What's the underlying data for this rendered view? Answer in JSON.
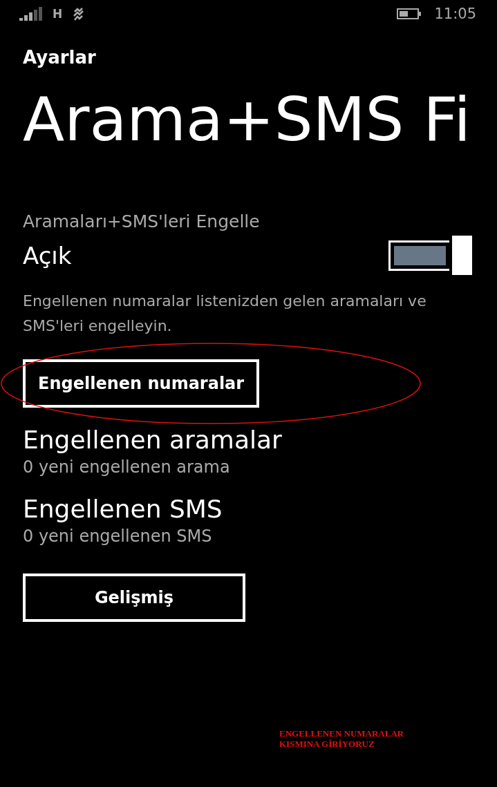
{
  "status_bar": {
    "network": "H",
    "time": "11:05"
  },
  "header": {
    "app": "Ayarlar",
    "title": "Arama+SMS Fi"
  },
  "block_toggle": {
    "label": "Aramaları+SMS'leri Engelle",
    "state_text": "Açık",
    "on": true,
    "description": "Engellenen numaralar listenizden gelen aramaları ve SMS'leri engelleyin."
  },
  "blocked_numbers_button": {
    "label": "Engellenen numaralar",
    "highlighted": true
  },
  "sections": [
    {
      "title": "Engellenen aramalar",
      "subtitle": "0 yeni engellenen arama"
    },
    {
      "title": "Engellenen SMS",
      "subtitle": "0 yeni engellenen SMS"
    }
  ],
  "advanced_button": {
    "label": "Gelişmiş"
  },
  "annotation": [
    "ENGELLENEN NUMARALAR",
    "KISMINA GİRİYORUZ"
  ]
}
